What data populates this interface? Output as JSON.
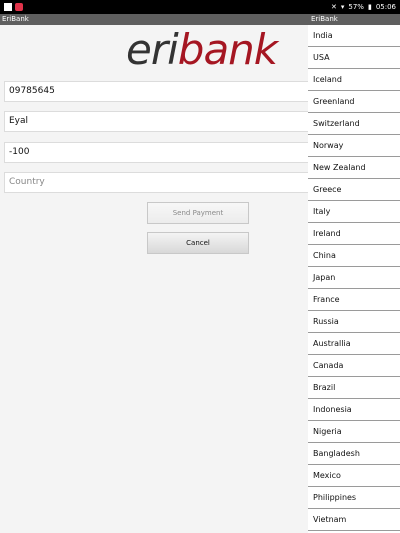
{
  "status_bar": {
    "right_text": "57%",
    "time": "05:06"
  },
  "window": {
    "title": "EriBank",
    "drawer_title": "EriBank"
  },
  "logo": {
    "part1": "eri",
    "part2": "bank",
    "colors": {
      "eri": "#333333",
      "bank": "#a51622"
    }
  },
  "form": {
    "phone_value": "09785645",
    "name_value": "Eyal",
    "amount_value": "-100",
    "country_placeholder": "Country",
    "send_label": "Send Payment",
    "cancel_label": "Cancel"
  },
  "countries": [
    "India",
    "USA",
    "Iceland",
    "Greenland",
    "Switzerland",
    "Norway",
    "New Zealand",
    "Greece",
    "Italy",
    "Ireland",
    "China",
    "Japan",
    "France",
    "Russia",
    "Australlia",
    "Canada",
    "Brazil",
    "Indonesia",
    "Nigeria",
    "Bangladesh",
    "Mexico",
    "Philippines",
    "Vietnam"
  ]
}
